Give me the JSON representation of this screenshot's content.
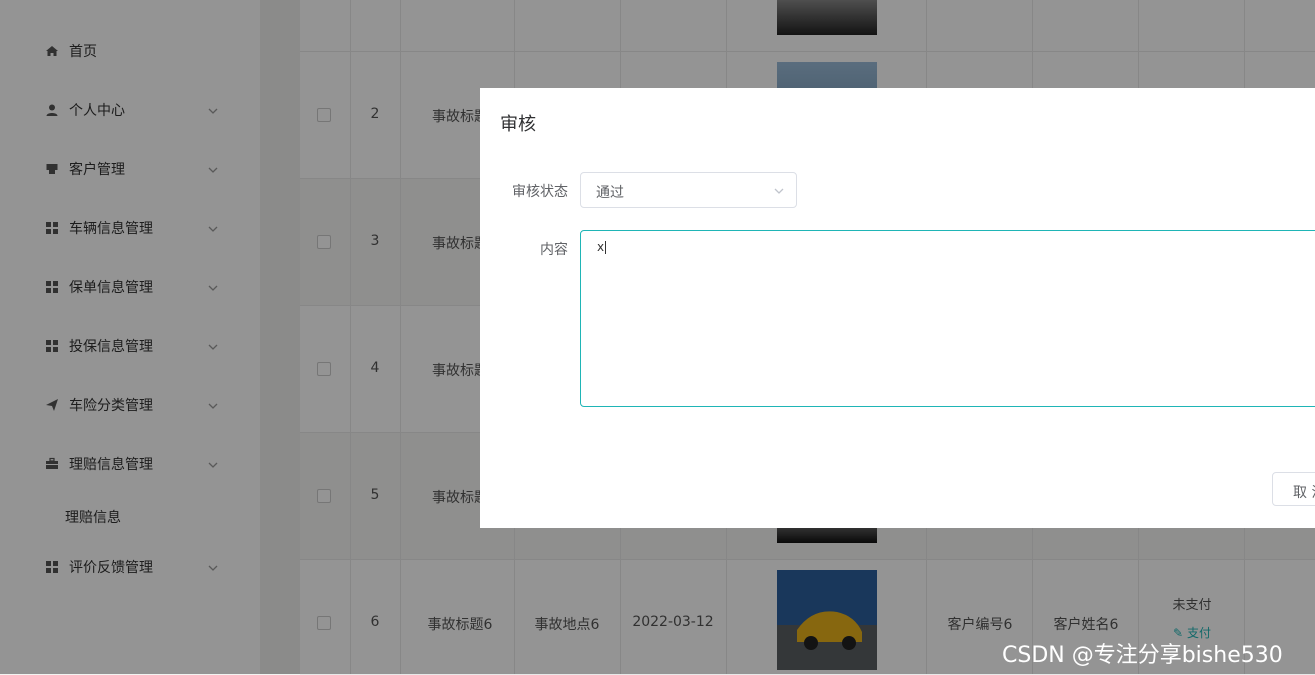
{
  "sidebar": {
    "items": [
      {
        "label": "首页",
        "icon": "home-icon"
      },
      {
        "label": "个人中心",
        "icon": "user-icon"
      },
      {
        "label": "客户管理",
        "icon": "tag-icon"
      },
      {
        "label": "车辆信息管理",
        "icon": "grid-icon"
      },
      {
        "label": "保单信息管理",
        "icon": "grid-icon"
      },
      {
        "label": "投保信息管理",
        "icon": "grid-icon"
      },
      {
        "label": "车险分类管理",
        "icon": "send-icon"
      },
      {
        "label": "理赔信息管理",
        "icon": "briefcase-icon"
      },
      {
        "label": "评价反馈管理",
        "icon": "grid-icon"
      }
    ],
    "sub_item": "理赔信息"
  },
  "table": {
    "rows": [
      {
        "index": "2",
        "title": "事故标题"
      },
      {
        "index": "3",
        "title": "事故标题"
      },
      {
        "index": "4",
        "title": "事故标题"
      },
      {
        "index": "5",
        "title": "事故标题"
      },
      {
        "index": "6",
        "title": "事故标题6",
        "location": "事故地点6",
        "date": "2022-03-12",
        "customer_no": "客户编号6",
        "customer_name": "客户姓名6",
        "pay_status": "未支付",
        "pay_action": "支付"
      }
    ]
  },
  "dialog": {
    "title": "审核",
    "status_label": "审核状态",
    "status_value": "通过",
    "content_label": "内容",
    "content_value": "x",
    "cancel_label": "取 消"
  },
  "watermark": "CSDN @专注分享bishe530"
}
